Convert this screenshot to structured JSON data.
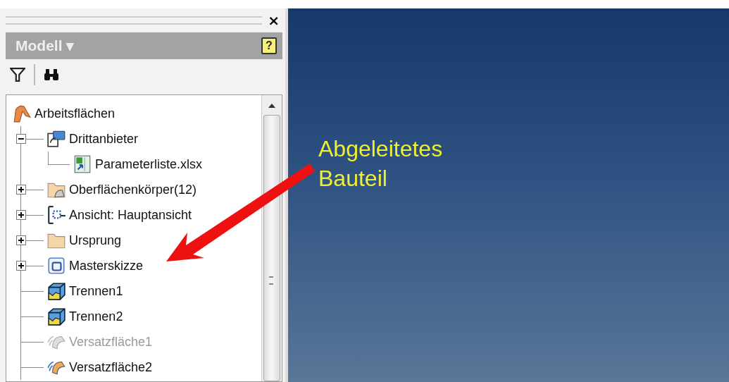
{
  "panel": {
    "close": "×",
    "title": "Modell",
    "title_caret": "▾",
    "help": "?"
  },
  "tree": {
    "label": "Arbeitsflächen",
    "kind": "work-planes",
    "children": [
      {
        "label": "Drittanbieter",
        "kind": "third-party",
        "expanded": true,
        "children": [
          {
            "label": "Parameterliste.xlsx",
            "kind": "spreadsheet"
          }
        ]
      },
      {
        "label": "Oberflächenkörper(12)",
        "kind": "surface-folder",
        "expanded": false
      },
      {
        "label": "Ansicht: Hauptansicht",
        "kind": "view",
        "expanded": false
      },
      {
        "label": "Ursprung",
        "kind": "folder",
        "expanded": false
      },
      {
        "label": "Masterskizze",
        "kind": "sketch",
        "expanded": false
      },
      {
        "label": "Trennen1",
        "kind": "split",
        "disabled": false
      },
      {
        "label": "Trennen2",
        "kind": "split",
        "disabled": false
      },
      {
        "label": "Versatzfläche1",
        "kind": "offset",
        "disabled": true
      },
      {
        "label": "Versatzfläche2",
        "kind": "offset",
        "disabled": false
      }
    ]
  },
  "annotation_lines": [
    "Abgeleitetes",
    "Bauteil"
  ]
}
